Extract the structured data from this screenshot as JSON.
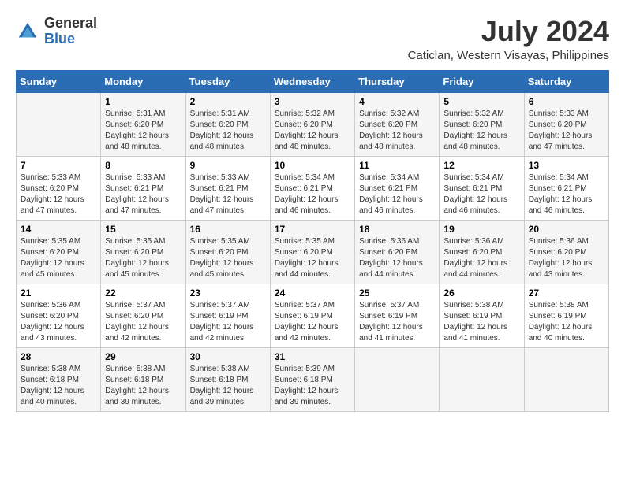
{
  "logo": {
    "general": "General",
    "blue": "Blue"
  },
  "header": {
    "month": "July 2024",
    "location": "Caticlan, Western Visayas, Philippines"
  },
  "days_of_week": [
    "Sunday",
    "Monday",
    "Tuesday",
    "Wednesday",
    "Thursday",
    "Friday",
    "Saturday"
  ],
  "weeks": [
    [
      {
        "day": "",
        "info": ""
      },
      {
        "day": "1",
        "info": "Sunrise: 5:31 AM\nSunset: 6:20 PM\nDaylight: 12 hours and 48 minutes."
      },
      {
        "day": "2",
        "info": "Sunrise: 5:31 AM\nSunset: 6:20 PM\nDaylight: 12 hours and 48 minutes."
      },
      {
        "day": "3",
        "info": "Sunrise: 5:32 AM\nSunset: 6:20 PM\nDaylight: 12 hours and 48 minutes."
      },
      {
        "day": "4",
        "info": "Sunrise: 5:32 AM\nSunset: 6:20 PM\nDaylight: 12 hours and 48 minutes."
      },
      {
        "day": "5",
        "info": "Sunrise: 5:32 AM\nSunset: 6:20 PM\nDaylight: 12 hours and 48 minutes."
      },
      {
        "day": "6",
        "info": "Sunrise: 5:33 AM\nSunset: 6:20 PM\nDaylight: 12 hours and 47 minutes."
      }
    ],
    [
      {
        "day": "7",
        "info": "Sunrise: 5:33 AM\nSunset: 6:20 PM\nDaylight: 12 hours and 47 minutes."
      },
      {
        "day": "8",
        "info": "Sunrise: 5:33 AM\nSunset: 6:21 PM\nDaylight: 12 hours and 47 minutes."
      },
      {
        "day": "9",
        "info": "Sunrise: 5:33 AM\nSunset: 6:21 PM\nDaylight: 12 hours and 47 minutes."
      },
      {
        "day": "10",
        "info": "Sunrise: 5:34 AM\nSunset: 6:21 PM\nDaylight: 12 hours and 46 minutes."
      },
      {
        "day": "11",
        "info": "Sunrise: 5:34 AM\nSunset: 6:21 PM\nDaylight: 12 hours and 46 minutes."
      },
      {
        "day": "12",
        "info": "Sunrise: 5:34 AM\nSunset: 6:21 PM\nDaylight: 12 hours and 46 minutes."
      },
      {
        "day": "13",
        "info": "Sunrise: 5:34 AM\nSunset: 6:21 PM\nDaylight: 12 hours and 46 minutes."
      }
    ],
    [
      {
        "day": "14",
        "info": "Sunrise: 5:35 AM\nSunset: 6:20 PM\nDaylight: 12 hours and 45 minutes."
      },
      {
        "day": "15",
        "info": "Sunrise: 5:35 AM\nSunset: 6:20 PM\nDaylight: 12 hours and 45 minutes."
      },
      {
        "day": "16",
        "info": "Sunrise: 5:35 AM\nSunset: 6:20 PM\nDaylight: 12 hours and 45 minutes."
      },
      {
        "day": "17",
        "info": "Sunrise: 5:35 AM\nSunset: 6:20 PM\nDaylight: 12 hours and 44 minutes."
      },
      {
        "day": "18",
        "info": "Sunrise: 5:36 AM\nSunset: 6:20 PM\nDaylight: 12 hours and 44 minutes."
      },
      {
        "day": "19",
        "info": "Sunrise: 5:36 AM\nSunset: 6:20 PM\nDaylight: 12 hours and 44 minutes."
      },
      {
        "day": "20",
        "info": "Sunrise: 5:36 AM\nSunset: 6:20 PM\nDaylight: 12 hours and 43 minutes."
      }
    ],
    [
      {
        "day": "21",
        "info": "Sunrise: 5:36 AM\nSunset: 6:20 PM\nDaylight: 12 hours and 43 minutes."
      },
      {
        "day": "22",
        "info": "Sunrise: 5:37 AM\nSunset: 6:20 PM\nDaylight: 12 hours and 42 minutes."
      },
      {
        "day": "23",
        "info": "Sunrise: 5:37 AM\nSunset: 6:19 PM\nDaylight: 12 hours and 42 minutes."
      },
      {
        "day": "24",
        "info": "Sunrise: 5:37 AM\nSunset: 6:19 PM\nDaylight: 12 hours and 42 minutes."
      },
      {
        "day": "25",
        "info": "Sunrise: 5:37 AM\nSunset: 6:19 PM\nDaylight: 12 hours and 41 minutes."
      },
      {
        "day": "26",
        "info": "Sunrise: 5:38 AM\nSunset: 6:19 PM\nDaylight: 12 hours and 41 minutes."
      },
      {
        "day": "27",
        "info": "Sunrise: 5:38 AM\nSunset: 6:19 PM\nDaylight: 12 hours and 40 minutes."
      }
    ],
    [
      {
        "day": "28",
        "info": "Sunrise: 5:38 AM\nSunset: 6:18 PM\nDaylight: 12 hours and 40 minutes."
      },
      {
        "day": "29",
        "info": "Sunrise: 5:38 AM\nSunset: 6:18 PM\nDaylight: 12 hours and 39 minutes."
      },
      {
        "day": "30",
        "info": "Sunrise: 5:38 AM\nSunset: 6:18 PM\nDaylight: 12 hours and 39 minutes."
      },
      {
        "day": "31",
        "info": "Sunrise: 5:39 AM\nSunset: 6:18 PM\nDaylight: 12 hours and 39 minutes."
      },
      {
        "day": "",
        "info": ""
      },
      {
        "day": "",
        "info": ""
      },
      {
        "day": "",
        "info": ""
      }
    ]
  ]
}
